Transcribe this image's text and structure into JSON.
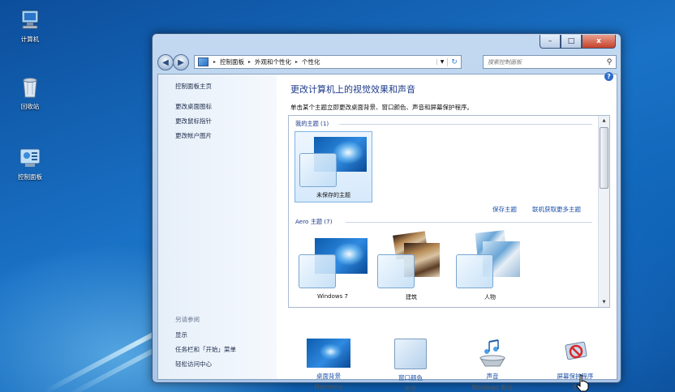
{
  "desktop": {
    "icons": [
      {
        "label": "计算机",
        "icon": "computer-icon"
      },
      {
        "label": "回收站",
        "icon": "recycle-bin-icon"
      },
      {
        "label": "控制面板",
        "icon": "control-panel-icon"
      }
    ]
  },
  "window": {
    "buttons": {
      "minimize": "–",
      "maximize": "□",
      "close": "x"
    },
    "nav": {
      "back": "◀",
      "forward": "▶"
    },
    "address": {
      "segments": [
        "控制面板",
        "外观和个性化",
        "个性化"
      ],
      "separator": "▸"
    },
    "search": {
      "placeholder": "搜索控制面板"
    }
  },
  "sidebar": {
    "links": [
      "控制面板主页",
      "更改桌面图标",
      "更改鼠标指针",
      "更改帐户图片"
    ],
    "see_also_title": "另请参阅",
    "see_also": [
      "显示",
      "任务栏和「开始」菜单",
      "轻松访问中心"
    ]
  },
  "main": {
    "help": "?",
    "title": "更改计算机上的视觉效果和声音",
    "subtitle": "单击某个主题立即更改桌面背景、窗口颜色、声音和屏幕保护程序。",
    "my_themes": {
      "header": "我的主题 (1)",
      "items": [
        {
          "name": "未保存的主题"
        }
      ],
      "save_link": "保存主题",
      "online_link": "联机获取更多主题"
    },
    "aero_themes": {
      "header": "Aero 主题 (7)",
      "items": [
        {
          "name": "Windows 7"
        },
        {
          "name": "建筑"
        },
        {
          "name": "人物"
        }
      ]
    }
  },
  "bottom": [
    {
      "name": "桌面背景",
      "value": "Harmony",
      "icon": "desktop-background-icon"
    },
    {
      "name": "窗口颜色",
      "value": "天空",
      "icon": "window-color-icon"
    },
    {
      "name": "声音",
      "value": "Windows 默认",
      "icon": "sound-icon"
    },
    {
      "name": "屏幕保护程序",
      "value": "无",
      "icon": "screensaver-icon"
    }
  ]
}
